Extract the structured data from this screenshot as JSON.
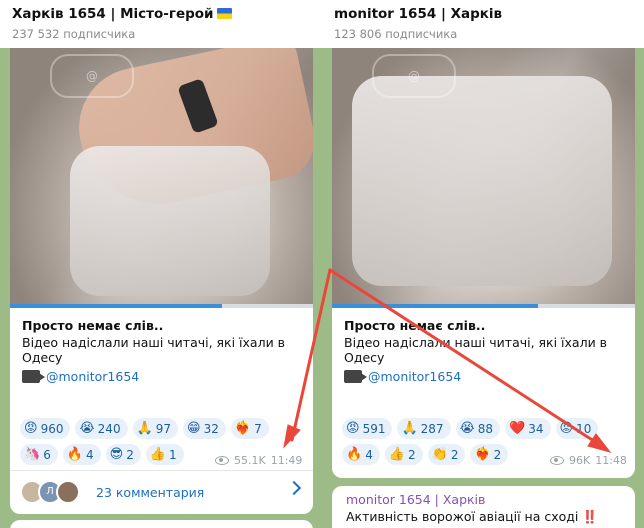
{
  "left": {
    "channel_title": "Харків 1654 | Місто-герой",
    "subscribers": "237 532 подписчика",
    "post": {
      "title": "Просто немає слів..",
      "text": "Відео надіслали наші читачі, які їхали в Одесу",
      "link": "@monitor1654",
      "progress": 0.7,
      "reactions": [
        {
          "emoji": "😡",
          "count": "960"
        },
        {
          "emoji": "😭",
          "count": "240"
        },
        {
          "emoji": "🙏",
          "count": "97"
        },
        {
          "emoji": "😁",
          "count": "32"
        },
        {
          "emoji": "❤️‍🔥",
          "count": "7"
        },
        {
          "emoji": "🦄",
          "count": "6"
        },
        {
          "emoji": "🔥",
          "count": "4"
        },
        {
          "emoji": "😎",
          "count": "2"
        },
        {
          "emoji": "👍",
          "count": "1"
        }
      ],
      "views": "55.1K",
      "time": "11:49",
      "comments_label": "23 комментария",
      "avatar_letter": "Л"
    }
  },
  "right": {
    "channel_title": "monitor 1654 | Харків",
    "subscribers": "123 806 подписчика",
    "post": {
      "title": "Просто немає слів..",
      "text": "Відео надіслали наші читачі, які їхали в Одесу",
      "link": "@monitor1654",
      "progress": 0.68,
      "reactions": [
        {
          "emoji": "😡",
          "count": "591"
        },
        {
          "emoji": "🙏",
          "count": "287"
        },
        {
          "emoji": "😭",
          "count": "88"
        },
        {
          "emoji": "❤️",
          "count": "34"
        },
        {
          "emoji": "😡",
          "count": "10"
        },
        {
          "emoji": "🔥",
          "count": "4"
        },
        {
          "emoji": "👍",
          "count": "2"
        },
        {
          "emoji": "👏",
          "count": "2"
        },
        {
          "emoji": "❤️‍🔥",
          "count": "2"
        }
      ],
      "views": "96K",
      "time": "11:48"
    },
    "next_post": {
      "sender": "monitor 1654 | Харків",
      "text": "Активність ворожої авіації на сході",
      "suffix": "‼️"
    }
  },
  "annotation_color": "#e8473a"
}
